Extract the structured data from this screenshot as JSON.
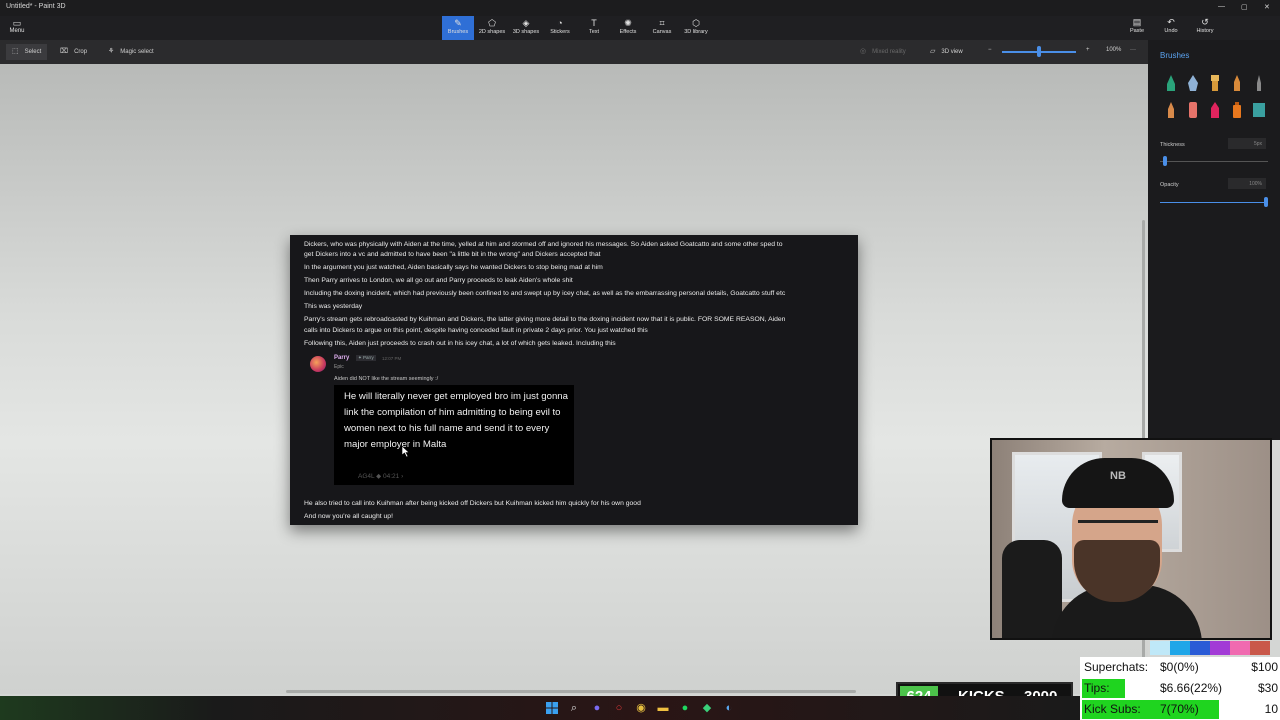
{
  "window": {
    "title": "Untitled* - Paint 3D",
    "minimize": "—",
    "maximize": "▢",
    "close": "✕"
  },
  "ribbon": {
    "menu_label": "Menu",
    "tools": [
      {
        "label": "Brushes",
        "icon": "brush-icon"
      },
      {
        "label": "2D shapes",
        "icon": "2d-shapes-icon"
      },
      {
        "label": "3D shapes",
        "icon": "3d-shapes-icon"
      },
      {
        "label": "Stickers",
        "icon": "stickers-icon"
      },
      {
        "label": "Text",
        "icon": "text-icon"
      },
      {
        "label": "Effects",
        "icon": "effects-icon"
      },
      {
        "label": "Canvas",
        "icon": "canvas-icon"
      },
      {
        "label": "3D library",
        "icon": "3d-library-icon"
      }
    ],
    "right_tools": [
      {
        "label": "Paste",
        "icon": "paste-icon"
      },
      {
        "label": "Undo",
        "icon": "undo-icon"
      },
      {
        "label": "History",
        "icon": "history-icon"
      }
    ]
  },
  "subbar": {
    "select": "Select",
    "crop": "Crop",
    "magic_select": "Magic select",
    "mixed_reality": "Mixed reality",
    "view_3d": "3D view",
    "zoom": "100%",
    "more": "···"
  },
  "panel": {
    "title": "Brushes",
    "thickness_label": "Thickness",
    "thickness_value": "5px",
    "opacity_label": "Opacity",
    "opacity_value": "100%"
  },
  "document": {
    "lines": [
      "Dickers, who was physically with Aiden at the time, yelled at him and stormed off and ignored his messages. So Aiden asked Goatcatto and some other sped to",
      "get Dickers into a vc and admitted to have been \"a little bit in the wrong\" and Dickers accepted that",
      "In the argument you just watched, Aiden basically says he wanted Dickers to stop being mad at him",
      "Then Parry arrives to London, we all go out and Parry proceeds to leak Aiden's whole shit",
      "Including the doxing incident, which had previously been confined to and swept up by icey chat, as well as the embarrassing personal details, Goatcatto stuff etc",
      "This was yesterday",
      "Parry's stream gets rebroadcasted by Kuihman and Dickers, the latter giving more detail to the doxing incident now that it is public. FOR SOME REASON, Aiden",
      "calls into Dickers to argue on this point, despite having conceded fault in private 2 days prior. You just watched this",
      "Following this, Aiden just proceeds to crash out in his icey chat, a lot of which gets leaked. Including this"
    ],
    "message": {
      "author": "Parry",
      "tag": "✦ Parry",
      "time": "12:07 PM",
      "sub": "Epic",
      "text": "Aiden did NOT like the stream seemingly :/",
      "clip_text": "He will literally never get employed bro im just gonna link the compilation of him admitting to being evil to women next to his full name and send it to every major employer in Malta",
      "clip_footer": "AG4L  ◆  04:21  ›"
    },
    "after_lines": [
      "He also tried to call into Kuihman after being kicked off Dickers but Kuihman kicked him quickly for his own good",
      "And now you're all caught up!"
    ]
  },
  "overlay": {
    "kicks": {
      "count": "624",
      "label": "KICKS",
      "goal": "3000"
    },
    "goals": [
      {
        "label": "Superchats:",
        "value": "$0(0%)",
        "target": "$100",
        "progress": 0.0
      },
      {
        "label": "Tips:",
        "value": "$6.66(22%)",
        "target": "$30",
        "progress": 0.22
      },
      {
        "label": "Kick Subs:",
        "value": "7(70%)",
        "target": "10",
        "progress": 0.7
      }
    ]
  },
  "colors": {
    "accent": "#2f6fd6",
    "panel_title": "#5ba3f0",
    "goal_green": "#1fd41f",
    "kicks_green": "#4cc24a"
  }
}
